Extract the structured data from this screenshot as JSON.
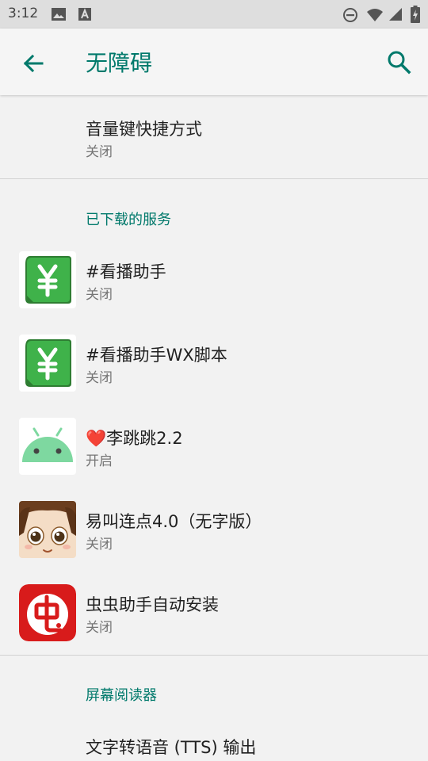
{
  "status_bar": {
    "time": "3:12",
    "icons": [
      "image-icon",
      "font-a-icon",
      "do-not-disturb-icon",
      "wifi-icon",
      "signal-icon",
      "battery-charging-icon"
    ]
  },
  "app_bar": {
    "title": "无障碍",
    "back_icon": "arrow-left-icon",
    "search_icon": "search-icon"
  },
  "colors": {
    "accent": "#00796b",
    "background": "#f2f2f2"
  },
  "volume_shortcut": {
    "title": "音量键快捷方式",
    "status": "关闭"
  },
  "downloaded_services": {
    "header": "已下载的服务",
    "items": [
      {
        "title": "#看播助手",
        "status": "关闭",
        "icon": "yen-green-icon"
      },
      {
        "title": "#看播助手WX脚本",
        "status": "关闭",
        "icon": "yen-green-icon"
      },
      {
        "title_prefix": "❤️",
        "title": "李跳跳2.2",
        "status": "开启",
        "icon": "android-icon"
      },
      {
        "title": "易叫连点4.0（无字版）",
        "status": "关闭",
        "icon": "cartoon-face-icon"
      },
      {
        "title": "虫虫助手自动安装",
        "status": "关闭",
        "icon": "chongchong-icon"
      }
    ]
  },
  "screen_readers": {
    "header": "屏幕阅读器",
    "items": [
      {
        "title": "文字转语音 (TTS) 输出"
      }
    ]
  }
}
